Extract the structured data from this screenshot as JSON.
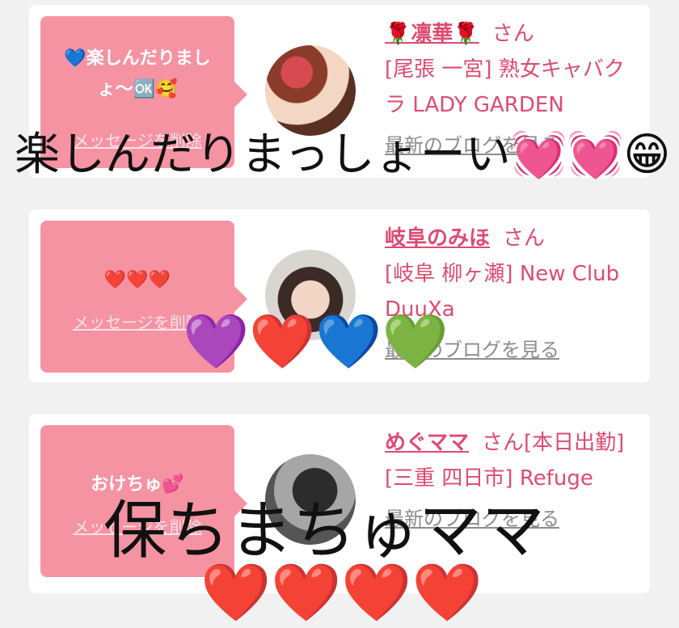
{
  "cards": [
    {
      "message": "💙楽しんだりましょ〜🆗🥰",
      "delete": "メッセージを削除",
      "name": "🌹凛華🌹",
      "san": "さん",
      "shop": "[尾張 一宮] 熟女キャバクラ LADY GARDEN",
      "blog": "最新のブログを見る"
    },
    {
      "message": "❤️❤️❤️",
      "delete": "メッセージを削除",
      "name": "岐阜のみほ",
      "san": "さん",
      "shop": "[岐阜 柳ヶ瀬] New Club DuuXa",
      "blog": "最新のブログを見る"
    },
    {
      "message": "おけちゅ💕",
      "delete": "メッセージを削除",
      "name": "めぐママ",
      "san": "さん[本日出勤]",
      "shop": "[三重 四日市] Refuge",
      "blog": "最新のブログを見る"
    }
  ],
  "overlays": {
    "line1": "楽しんだりまっしょーい💓💓😁",
    "line2": "💜❤️💙💚",
    "line3": "保ちまちゅママ",
    "line4": "❤️❤️❤️❤️"
  }
}
